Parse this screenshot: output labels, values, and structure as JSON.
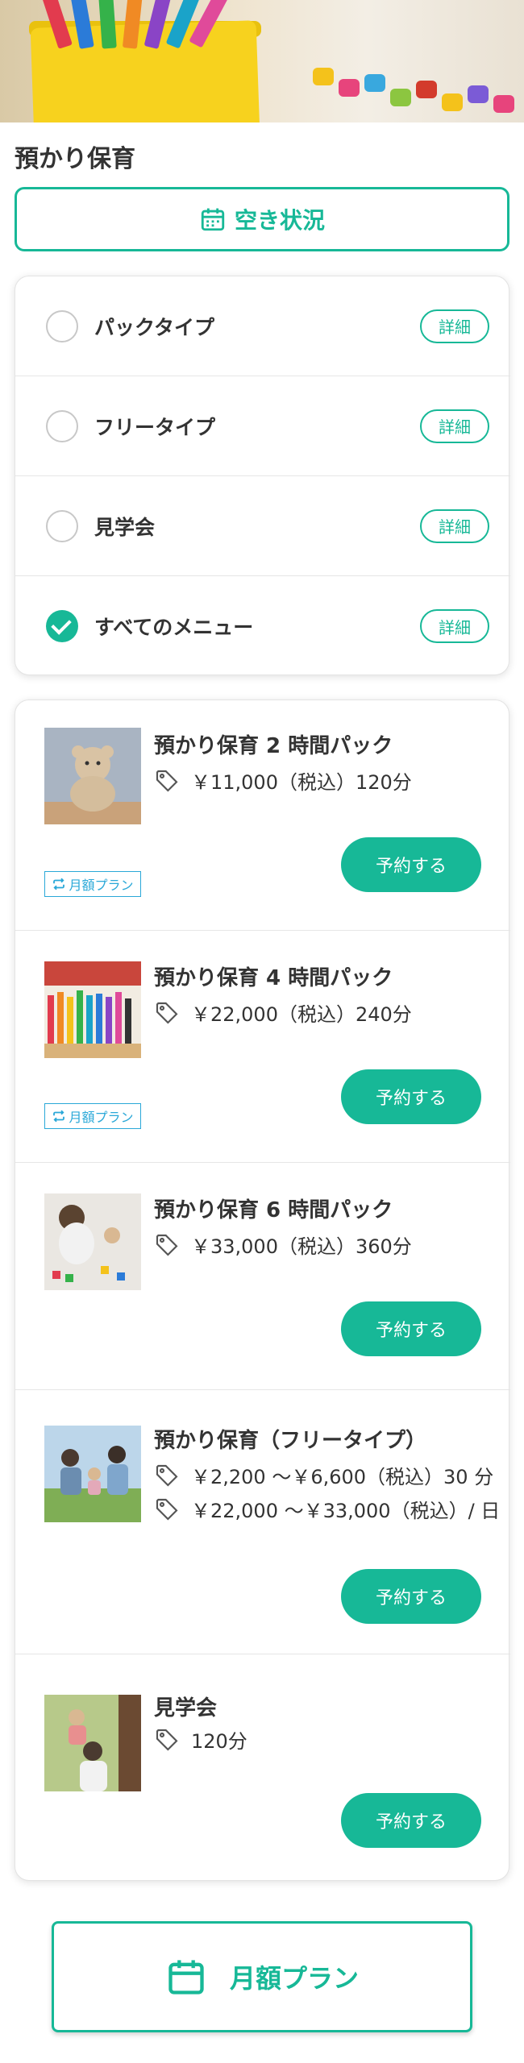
{
  "header": {
    "title": "預かり保育"
  },
  "availability_button": {
    "label": "空き状況",
    "icon": "calendar-icon"
  },
  "filters": [
    {
      "label": "パックタイプ",
      "checked": false,
      "detail": "詳細"
    },
    {
      "label": "フリータイプ",
      "checked": false,
      "detail": "詳細"
    },
    {
      "label": "見学会",
      "checked": false,
      "detail": "詳細"
    },
    {
      "label": "すべてのメニュー",
      "checked": true,
      "detail": "詳細"
    }
  ],
  "menu": [
    {
      "title": "預かり保育 2 時間パック",
      "prices": [
        "￥11,000（税込）120分"
      ],
      "reserve": "予約する",
      "badge": "月額プラン"
    },
    {
      "title": "預かり保育 4 時間パック",
      "prices": [
        "￥22,000（税込）240分"
      ],
      "reserve": "予約する",
      "badge": "月額プラン"
    },
    {
      "title": "預かり保育 6 時間パック",
      "prices": [
        "￥33,000（税込）360分"
      ],
      "reserve": "予約する"
    },
    {
      "title": "預かり保育（フリータイプ）",
      "prices": [
        "￥2,200 〜￥6,600（税込）30 分",
        "￥22,000 〜￥33,000（税込）/ 日"
      ],
      "reserve": "予約する"
    },
    {
      "title": "見学会",
      "prices": [
        "120分"
      ],
      "reserve": "予約する"
    }
  ],
  "monthly_plan_button": {
    "label": "月額プラン",
    "icon": "calendar-icon"
  },
  "colors": {
    "accent": "#17b897",
    "badge": "#2aa8d8"
  }
}
